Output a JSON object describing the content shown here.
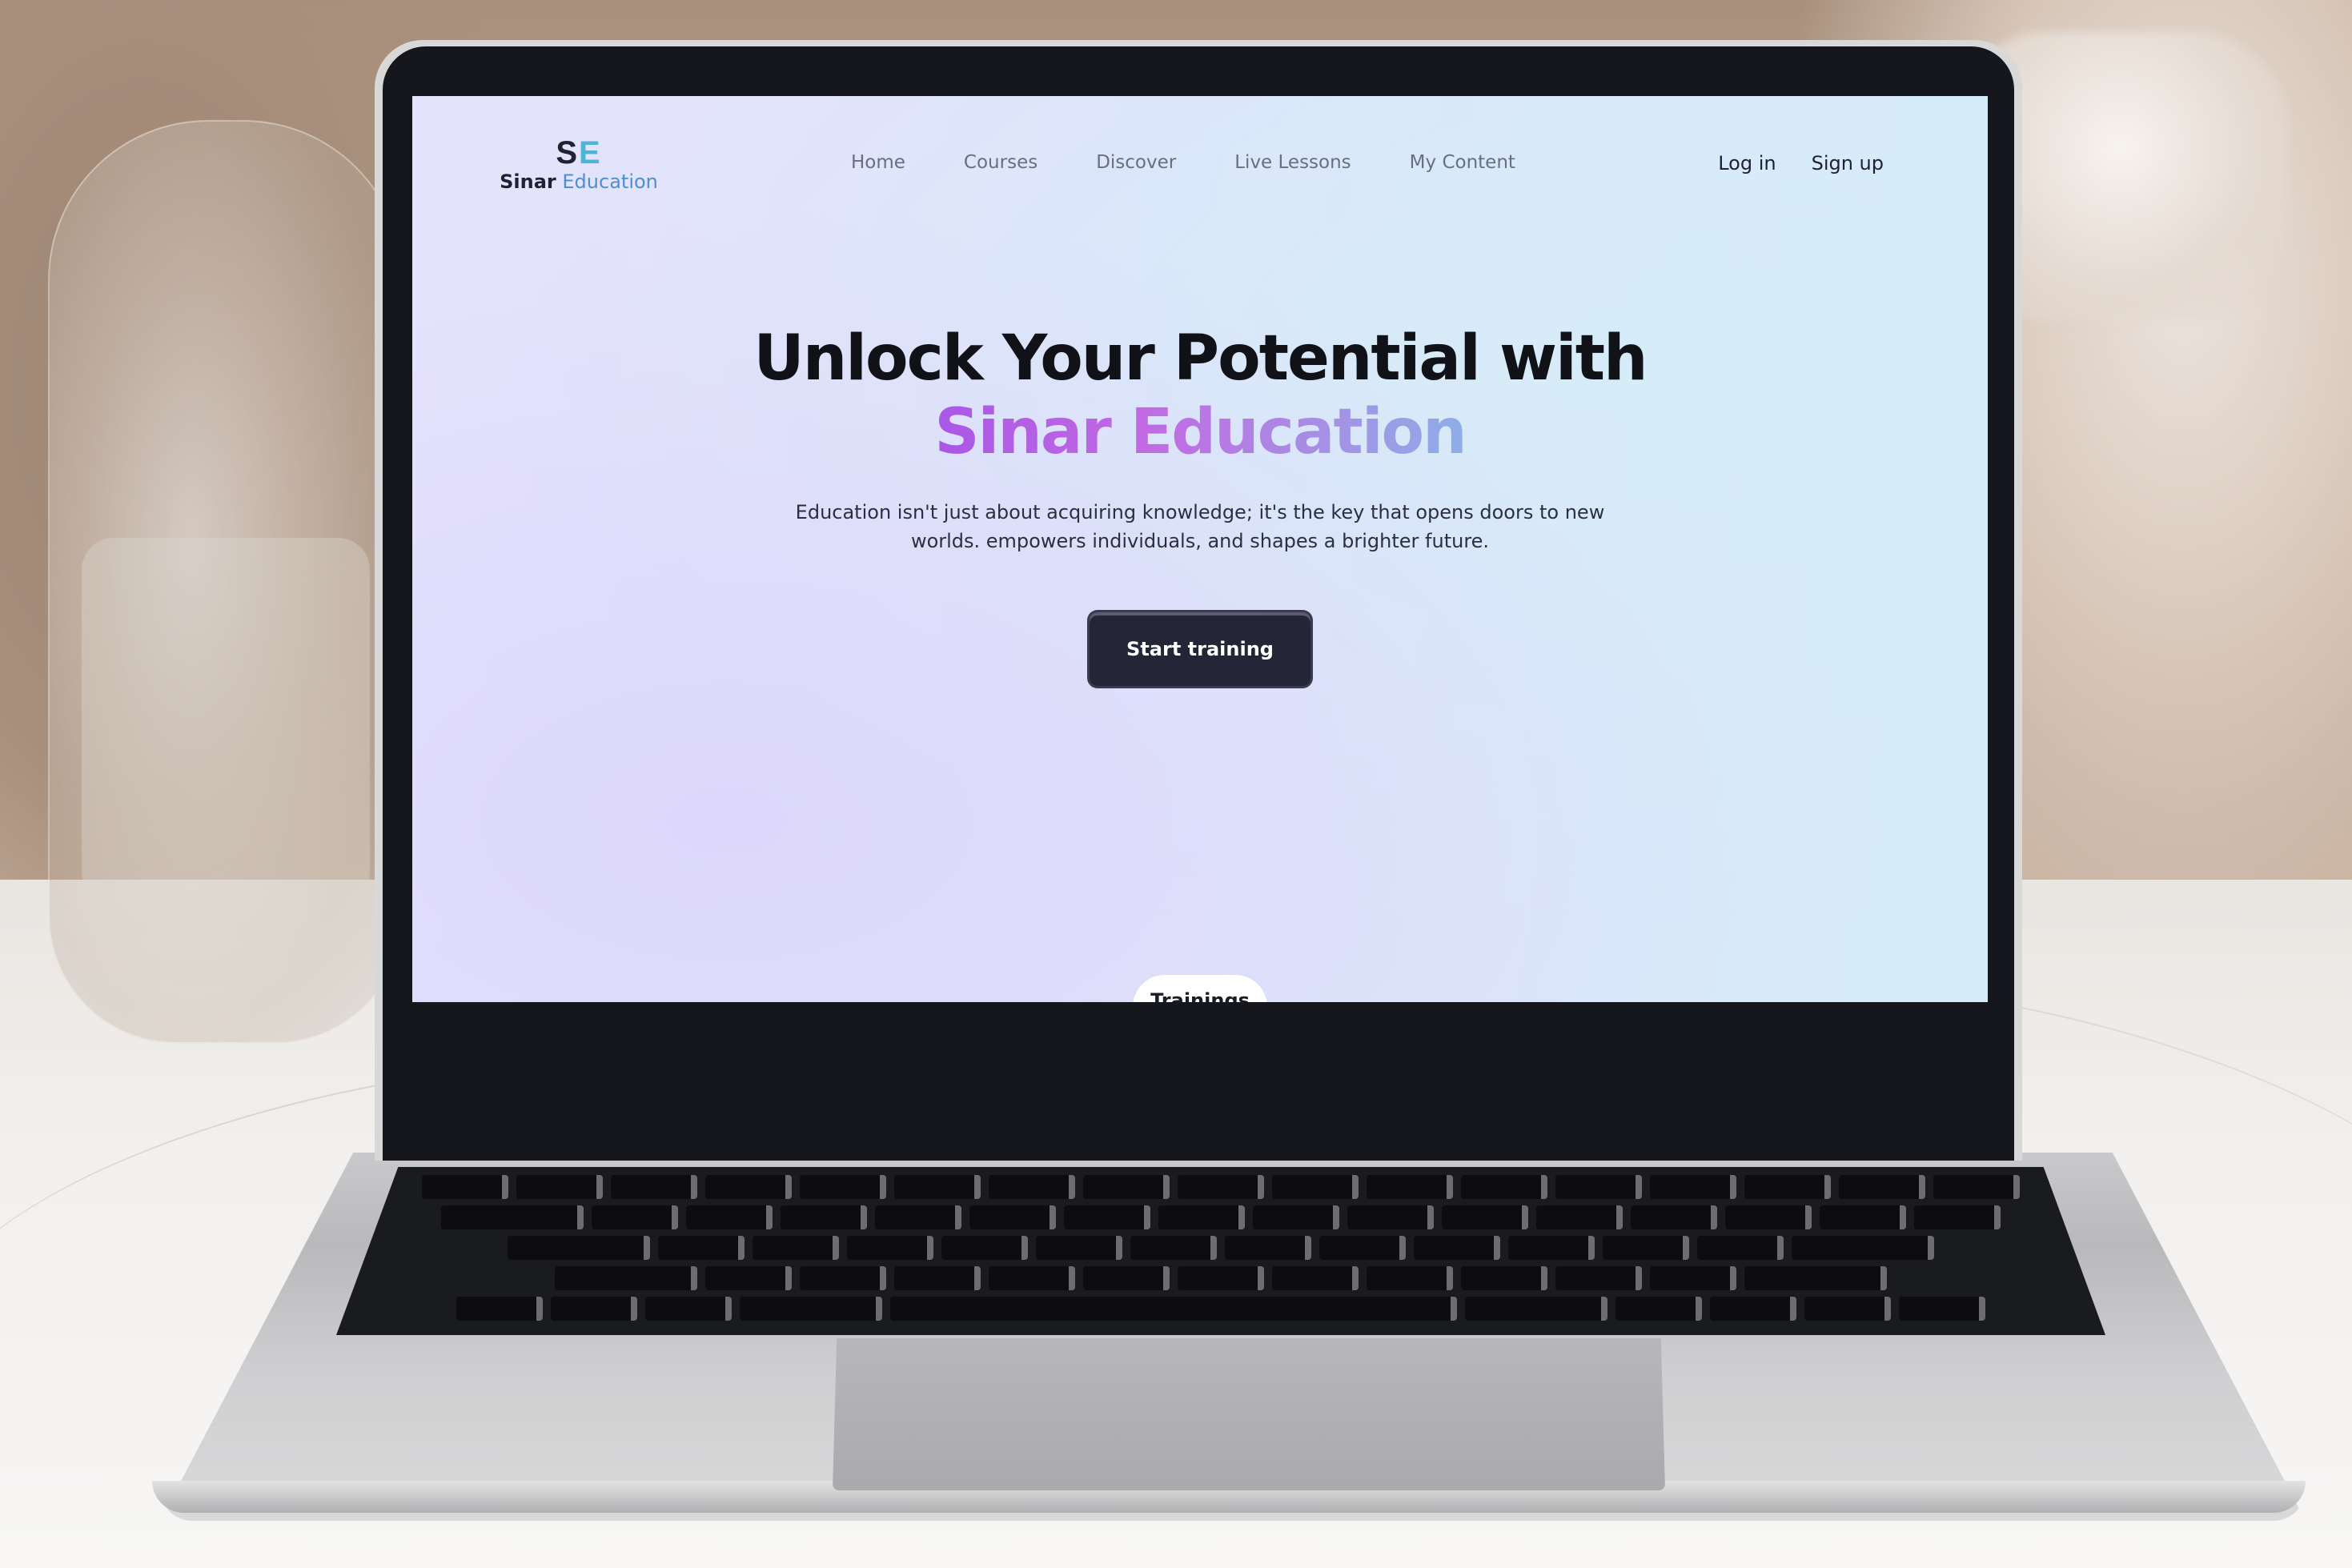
{
  "brand": {
    "mark_s": "S",
    "mark_e": "E",
    "name_primary": "Sinar",
    "name_secondary": "Education"
  },
  "nav": {
    "links": [
      "Home",
      "Courses",
      "Discover",
      "Live Lessons",
      "My Content"
    ],
    "login_label": "Log in",
    "signup_label": "Sign up"
  },
  "hero": {
    "title_line1": "Unlock Your Potential with",
    "title_line2": "Sinar Education",
    "subtitle": "Education isn't just about acquiring knowledge; it's the key that opens doors to new worlds. empowers individuals, and shapes a brighter future.",
    "cta_label": "Start training"
  },
  "next_section": {
    "tab_label": "Trainings"
  },
  "colors": {
    "accent_gradient_start": "#a957e6",
    "accent_gradient_end": "#8eaee6",
    "cta_background": "#242537",
    "logo_e": "#4fb4d8"
  }
}
